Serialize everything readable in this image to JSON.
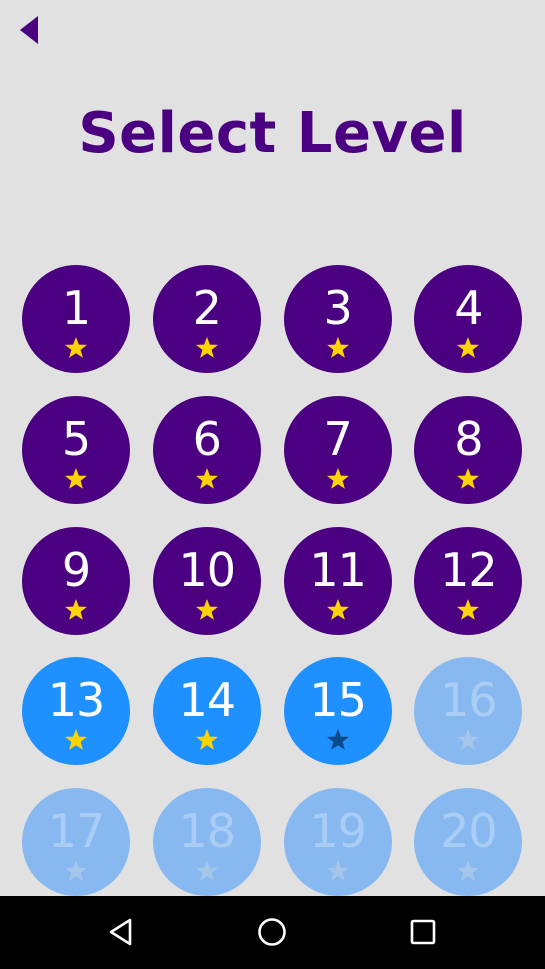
{
  "header": {
    "title": "Select Level",
    "back_icon": "back-arrow-icon"
  },
  "colors": {
    "background": "#e1e1e1",
    "title": "#4a0080",
    "completed": "#4a0080",
    "available": "#1e90ff",
    "locked": "#87b9f0",
    "star_gold": "#ffd400",
    "star_empty_dark": "#0a4a8a",
    "star_empty_light": "#a5c6ea"
  },
  "levels": [
    {
      "number": "1",
      "state": "completed",
      "star": "filled"
    },
    {
      "number": "2",
      "state": "completed",
      "star": "filled"
    },
    {
      "number": "3",
      "state": "completed",
      "star": "filled"
    },
    {
      "number": "4",
      "state": "completed",
      "star": "filled"
    },
    {
      "number": "5",
      "state": "completed",
      "star": "filled"
    },
    {
      "number": "6",
      "state": "completed",
      "star": "filled"
    },
    {
      "number": "7",
      "state": "completed",
      "star": "filled"
    },
    {
      "number": "8",
      "state": "completed",
      "star": "filled"
    },
    {
      "number": "9",
      "state": "completed",
      "star": "filled"
    },
    {
      "number": "10",
      "state": "completed",
      "star": "filled"
    },
    {
      "number": "11",
      "state": "completed",
      "star": "filled"
    },
    {
      "number": "12",
      "state": "completed",
      "star": "filled"
    },
    {
      "number": "13",
      "state": "available",
      "star": "filled"
    },
    {
      "number": "14",
      "state": "available",
      "star": "filled"
    },
    {
      "number": "15",
      "state": "available",
      "star": "empty"
    },
    {
      "number": "16",
      "state": "locked",
      "star": "empty"
    },
    {
      "number": "17",
      "state": "locked",
      "star": "empty"
    },
    {
      "number": "18",
      "state": "locked",
      "star": "empty"
    },
    {
      "number": "19",
      "state": "locked",
      "star": "empty"
    },
    {
      "number": "20",
      "state": "locked",
      "star": "empty"
    }
  ],
  "navbar": {
    "back_icon": "nav-back-icon",
    "home_icon": "nav-home-icon",
    "recents_icon": "nav-recents-icon"
  }
}
